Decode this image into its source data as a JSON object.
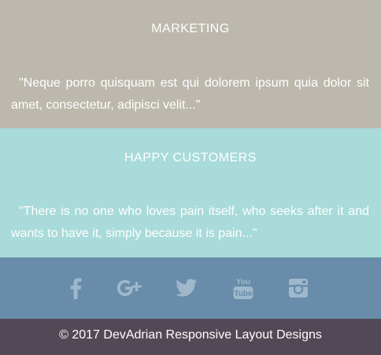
{
  "marketing": {
    "heading": "MARKETING",
    "quote": "\"Neque porro quisquam est qui dolorem ipsum quia dolor sit amet, consectetur, adipisci velit...\""
  },
  "customers": {
    "heading": "HAPPY CUSTOMERS",
    "quote": "\"There is no one who loves pain itself, who seeks after it and wants to have it, simply because it is pain...\""
  },
  "social": {
    "icons": [
      "facebook-icon",
      "google-plus-icon",
      "twitter-icon",
      "youtube-icon",
      "instagram-icon"
    ],
    "icon_color": "#9fb8cc",
    "youtube_top": "You",
    "youtube_bottom": "Tube"
  },
  "footer": {
    "copyright": "© 2017 DevAdrian Responsive Layout Designs"
  },
  "colors": {
    "marketing_bg": "#bdb8ad",
    "customers_bg": "#a8dbd9",
    "social_bg": "#688ca9",
    "footer_bg": "#534855",
    "text": "#ffffff"
  }
}
